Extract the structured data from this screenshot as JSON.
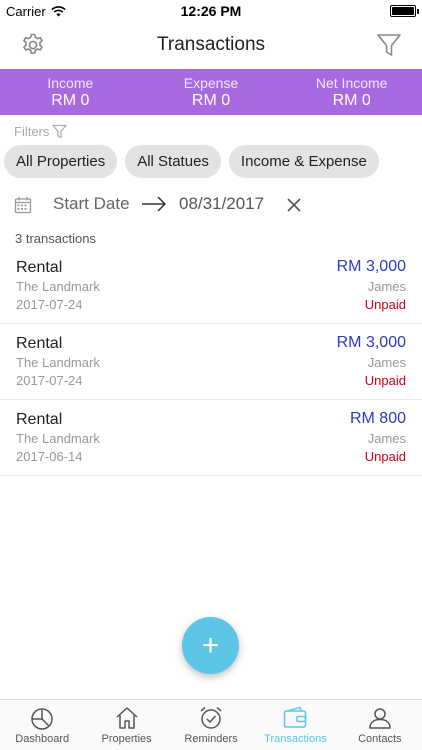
{
  "status_bar": {
    "carrier": "Carrier",
    "time": "12:26 PM"
  },
  "header": {
    "title": "Transactions",
    "left_icon": "gear-icon",
    "right_icon": "filter-icon"
  },
  "summary": [
    {
      "label": "Income",
      "value": "RM 0"
    },
    {
      "label": "Expense",
      "value": "RM 0"
    },
    {
      "label": "Net Income",
      "value": "RM 0"
    }
  ],
  "filters": {
    "label": "Filters",
    "chips": [
      "All Properties",
      "All Statues",
      "Income & Expense"
    ]
  },
  "date_range": {
    "start": "Start Date",
    "end": "08/31/2017"
  },
  "list": {
    "count_text": "3 transactions",
    "items": [
      {
        "name": "Rental",
        "property": "The Landmark",
        "date": "2017-07-24",
        "amount": "RM 3,000",
        "contact": "James",
        "status": "Unpaid"
      },
      {
        "name": "Rental",
        "property": "The Landmark",
        "date": "2017-07-24",
        "amount": "RM 3,000",
        "contact": "James",
        "status": "Unpaid"
      },
      {
        "name": "Rental",
        "property": "The Landmark",
        "date": "2017-06-14",
        "amount": "RM 800",
        "contact": "James",
        "status": "Unpaid"
      }
    ]
  },
  "fab": {
    "label": "+"
  },
  "tabs": [
    {
      "label": "Dashboard",
      "icon": "dashboard-icon",
      "active": false
    },
    {
      "label": "Properties",
      "icon": "home-icon",
      "active": false
    },
    {
      "label": "Reminders",
      "icon": "alarm-clock-icon",
      "active": false
    },
    {
      "label": "Transactions",
      "icon": "wallet-icon",
      "active": true
    },
    {
      "label": "Contacts",
      "icon": "person-icon",
      "active": false
    }
  ],
  "colors": {
    "accent": "#5bc6e6",
    "summary_bg": "#a86ae0",
    "amount": "#2a3cc4",
    "unpaid": "#d0021b"
  }
}
